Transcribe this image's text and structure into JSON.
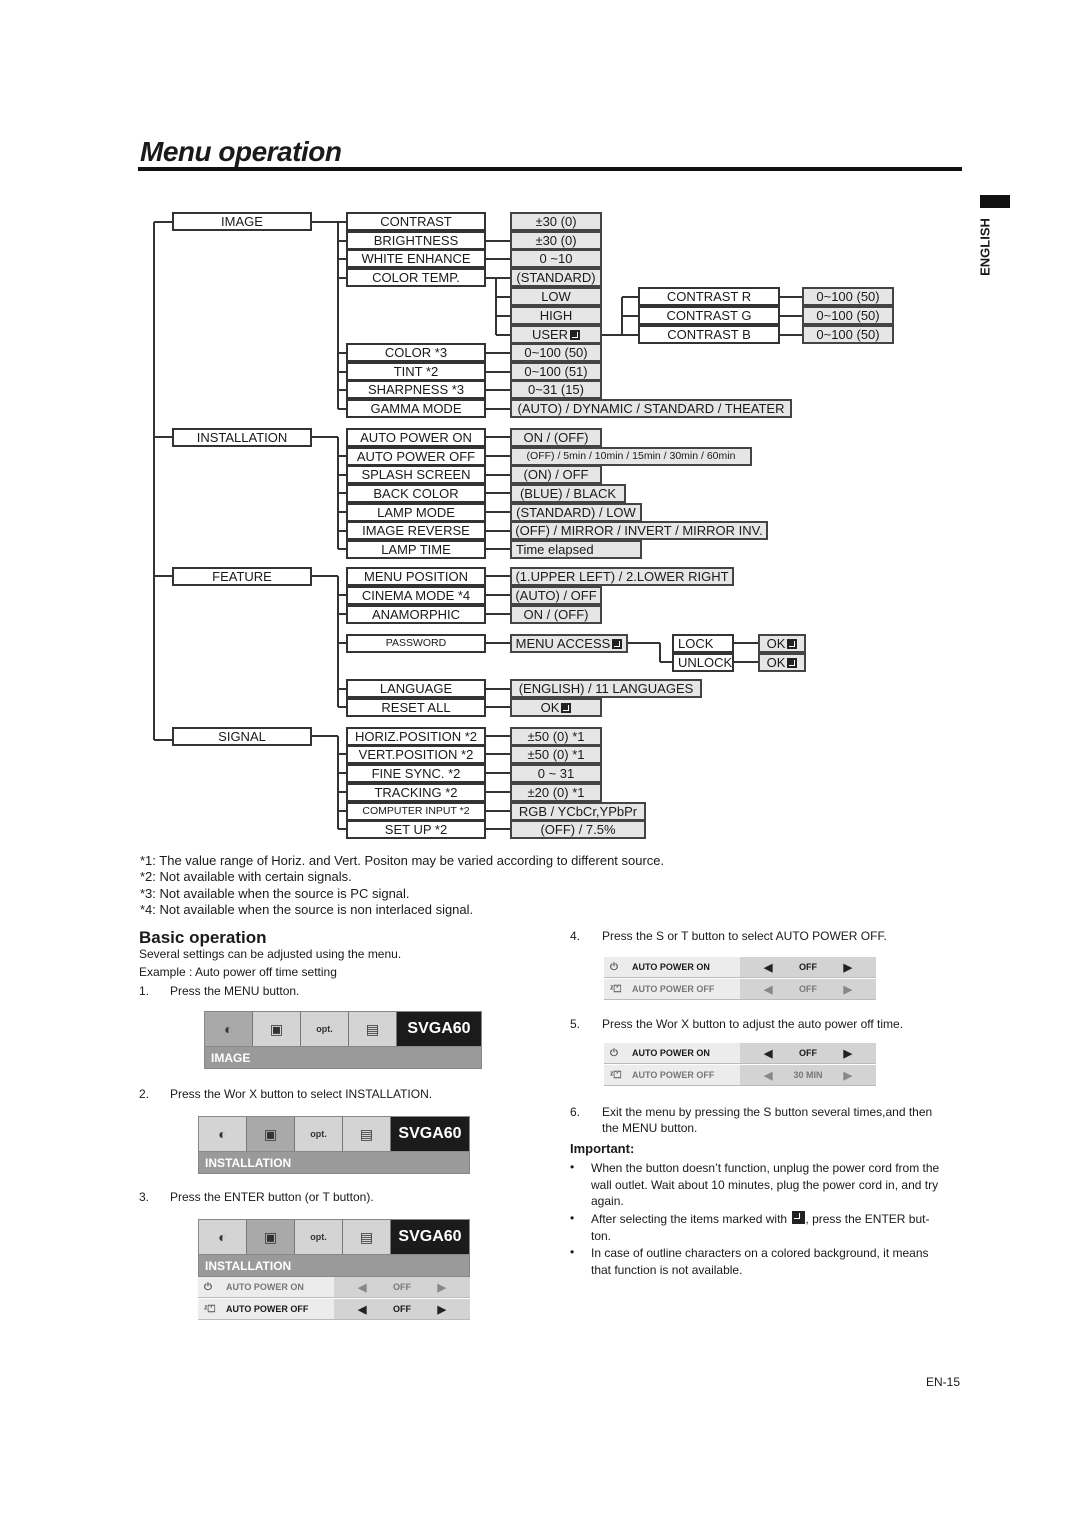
{
  "page": {
    "title": "Menu operation",
    "language_tab": "ENGLISH",
    "page_number": "EN-15"
  },
  "tree": {
    "categories": [
      "IMAGE",
      "INSTALLATION",
      "FEATURE",
      "SIGNAL"
    ],
    "image": {
      "items": [
        "CONTRAST",
        "BRIGHTNESS",
        "WHITE ENHANCE",
        "COLOR TEMP.",
        "COLOR   *3",
        "TINT     *2",
        "SHARPNESS *3",
        "GAMMA MODE"
      ],
      "values": [
        "±30 (0)",
        "±30 (0)",
        "0 ~10",
        "(STANDARD)",
        "LOW",
        "HIGH",
        "USER",
        "0~100 (50)",
        "0~100 (51)",
        "0~31 (15)",
        "(AUTO) / DYNAMIC / STANDARD / THEATER"
      ],
      "user_sub": [
        "CONTRAST R",
        "CONTRAST G",
        "CONTRAST B"
      ],
      "user_sub_values": [
        "0~100 (50)",
        "0~100 (50)",
        "0~100 (50)"
      ]
    },
    "installation": {
      "items": [
        "AUTO POWER ON",
        "AUTO POWER OFF",
        "SPLASH SCREEN",
        "BACK COLOR",
        "LAMP MODE",
        "IMAGE REVERSE",
        "LAMP TIME"
      ],
      "values": [
        "ON / (OFF)",
        "(OFF) / 5min / 10min / 15min / 30min / 60min",
        "(ON) / OFF",
        "(BLUE) / BLACK",
        "(STANDARD) / LOW",
        "(OFF) / MIRROR / INVERT / MIRROR INV.",
        "Time elapsed"
      ]
    },
    "feature": {
      "items": [
        "MENU POSITION",
        "CINEMA MODE *4",
        "ANAMORPHIC",
        "PASSWORD",
        "LANGUAGE",
        "RESET ALL"
      ],
      "values": [
        "(1.UPPER LEFT) / 2.LOWER RIGHT",
        "(AUTO) / OFF",
        "ON / (OFF)",
        "MENU ACCESS",
        "(ENGLISH) / 11 LANGUAGES",
        "OK"
      ],
      "password_sub": [
        "LOCK",
        "UNLOCK"
      ],
      "password_sub_values": [
        "OK",
        "OK"
      ]
    },
    "signal": {
      "items": [
        "HORIZ.POSITION *2",
        "VERT.POSITION *2",
        "FINE SYNC. *2",
        "TRACKING *2",
        "COMPUTER INPUT *2",
        "SET UP *2"
      ],
      "values": [
        "±50 (0)  *1",
        "±50 (0)  *1",
        "0 ~ 31",
        "±20 (0)  *1",
        "RGB / YCbCr,YPbPr",
        "(OFF) / 7.5%"
      ]
    }
  },
  "footnotes": [
    "*1: The value range of Horiz. and Vert. Positon may be varied according to different source.",
    "*2: Not available with certain signals.",
    "*3: Not available when the source is PC signal.",
    "*4: Not available when the source is non interlaced signal."
  ],
  "basic": {
    "title": "Basic operation",
    "intro": "Several settings can be adjusted using the menu.",
    "example": "Example : Auto power off time setting",
    "steps": [
      {
        "num": "1.",
        "text": "Press the MENU button."
      },
      {
        "num": "2.",
        "text": "Press the  Wor  X button to select INSTALLATION."
      },
      {
        "num": "3.",
        "text": "Press the ENTER button (or  T button)."
      },
      {
        "num": "4.",
        "text": "Press the  S or  T button to select AUTO POWER OFF."
      },
      {
        "num": "5.",
        "text": "Press the  Wor  X button to adjust the auto power off time."
      },
      {
        "num": "6.",
        "text": "Exit the menu by pressing the  S button several times,and then"
      },
      {
        "num": "",
        "text": "the MENU button."
      }
    ],
    "osd": {
      "model": "SVGA60",
      "icons": [
        "picture-icon",
        "installation-icon",
        "option-icon",
        "signal-icon"
      ],
      "opt_label": "opt.",
      "screens": [
        {
          "sub": "IMAGE"
        },
        {
          "sub": "INSTALLATION"
        },
        {
          "sub": "INSTALLATION",
          "rows": [
            {
              "label": "AUTO POWER ON",
              "value": "OFF"
            },
            {
              "label": "AUTO POWER OFF",
              "value": "OFF"
            }
          ]
        }
      ],
      "step4_rows": [
        {
          "label": "AUTO POWER ON",
          "value": "OFF"
        },
        {
          "label": "AUTO POWER OFF",
          "value": "OFF"
        }
      ],
      "step5_rows": [
        {
          "label": "AUTO POWER ON",
          "value": "OFF"
        },
        {
          "label": "AUTO POWER OFF",
          "value": "30 MIN"
        }
      ]
    },
    "important": {
      "title": "Important:",
      "bullets": [
        [
          "When the button doesn’t function, unplug the power cord from the",
          "wall outlet. Wait about 10 minutes, plug the power cord in, and try",
          "again."
        ],
        [
          "After selecting the items marked with",
          ", press the ENTER but-",
          "ton."
        ],
        [
          "In case of outline characters on a colored background, it means",
          "that function is not available."
        ]
      ]
    }
  }
}
